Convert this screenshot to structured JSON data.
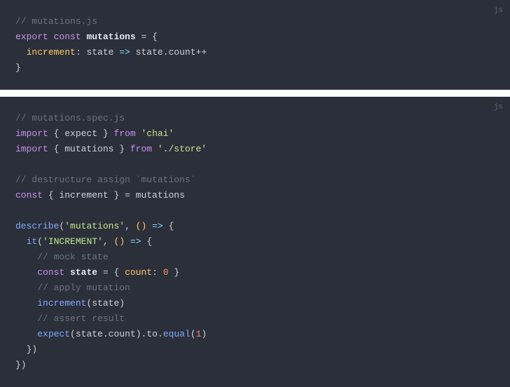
{
  "block1": {
    "lang": "js",
    "l1_comment": "// mutations.js",
    "l2_export": "export",
    "l2_const": "const",
    "l2_name": "mutations",
    "l2_eq": " = {",
    "l3_indent": "  ",
    "l3_prop": "increment",
    "l3_colon": ": ",
    "l3_param": "state",
    "l3_arrow": " => ",
    "l3_obj": "state",
    "l3_dot": ".",
    "l3_field": "count",
    "l3_op": "++",
    "l4": "}"
  },
  "block2": {
    "lang": "js",
    "l1_comment": "// mutations.spec.js",
    "l2_import": "import",
    "l2_brace_o": " { ",
    "l2_name": "expect",
    "l2_brace_c": " } ",
    "l2_from": "from",
    "l2_sp": " ",
    "l2_str": "'chai'",
    "l3_import": "import",
    "l3_brace_o": " { ",
    "l3_name": "mutations",
    "l3_brace_c": " } ",
    "l3_from": "from",
    "l3_sp": " ",
    "l3_str": "'./store'",
    "l5_comment": "// destructure assign `mutations`",
    "l6_const": "const",
    "l6_brace_o": " { ",
    "l6_name": "increment",
    "l6_brace_c": " } = ",
    "l6_rhs": "mutations",
    "l8_fn": "describe",
    "l8_po": "(",
    "l8_str": "'mutations'",
    "l8_comma": ", ",
    "l8_paren_o": "(",
    "l8_paren_c": ")",
    "l8_arrow": " => ",
    "l8_brace": "{",
    "l9_indent": "  ",
    "l9_fn": "it",
    "l9_po": "(",
    "l9_str": "'INCREMENT'",
    "l9_comma": ", ",
    "l9_paren_o": "(",
    "l9_paren_c": ")",
    "l9_arrow": " => ",
    "l9_brace": "{",
    "l10_indent": "    ",
    "l10_comment": "// mock state",
    "l11_indent": "    ",
    "l11_const": "const",
    "l11_sp": " ",
    "l11_name": "state",
    "l11_eq": " = { ",
    "l11_prop": "count",
    "l11_colon": ": ",
    "l11_num": "0",
    "l11_close": " }",
    "l12_indent": "    ",
    "l12_comment": "// apply mutation",
    "l13_indent": "    ",
    "l13_fn": "increment",
    "l13_po": "(",
    "l13_arg": "state",
    "l13_pc": ")",
    "l14_indent": "    ",
    "l14_comment": "// assert result",
    "l15_indent": "    ",
    "l15_fn": "expect",
    "l15_po": "(",
    "l15_obj": "state",
    "l15_dot1": ".",
    "l15_field": "count",
    "l15_pc": ")",
    "l15_dot2": ".",
    "l15_to": "to",
    "l15_dot3": ".",
    "l15_equal": "equal",
    "l15_po2": "(",
    "l15_num": "1",
    "l15_pc2": ")",
    "l16_indent": "  ",
    "l16": "})",
    "l17": "})"
  }
}
